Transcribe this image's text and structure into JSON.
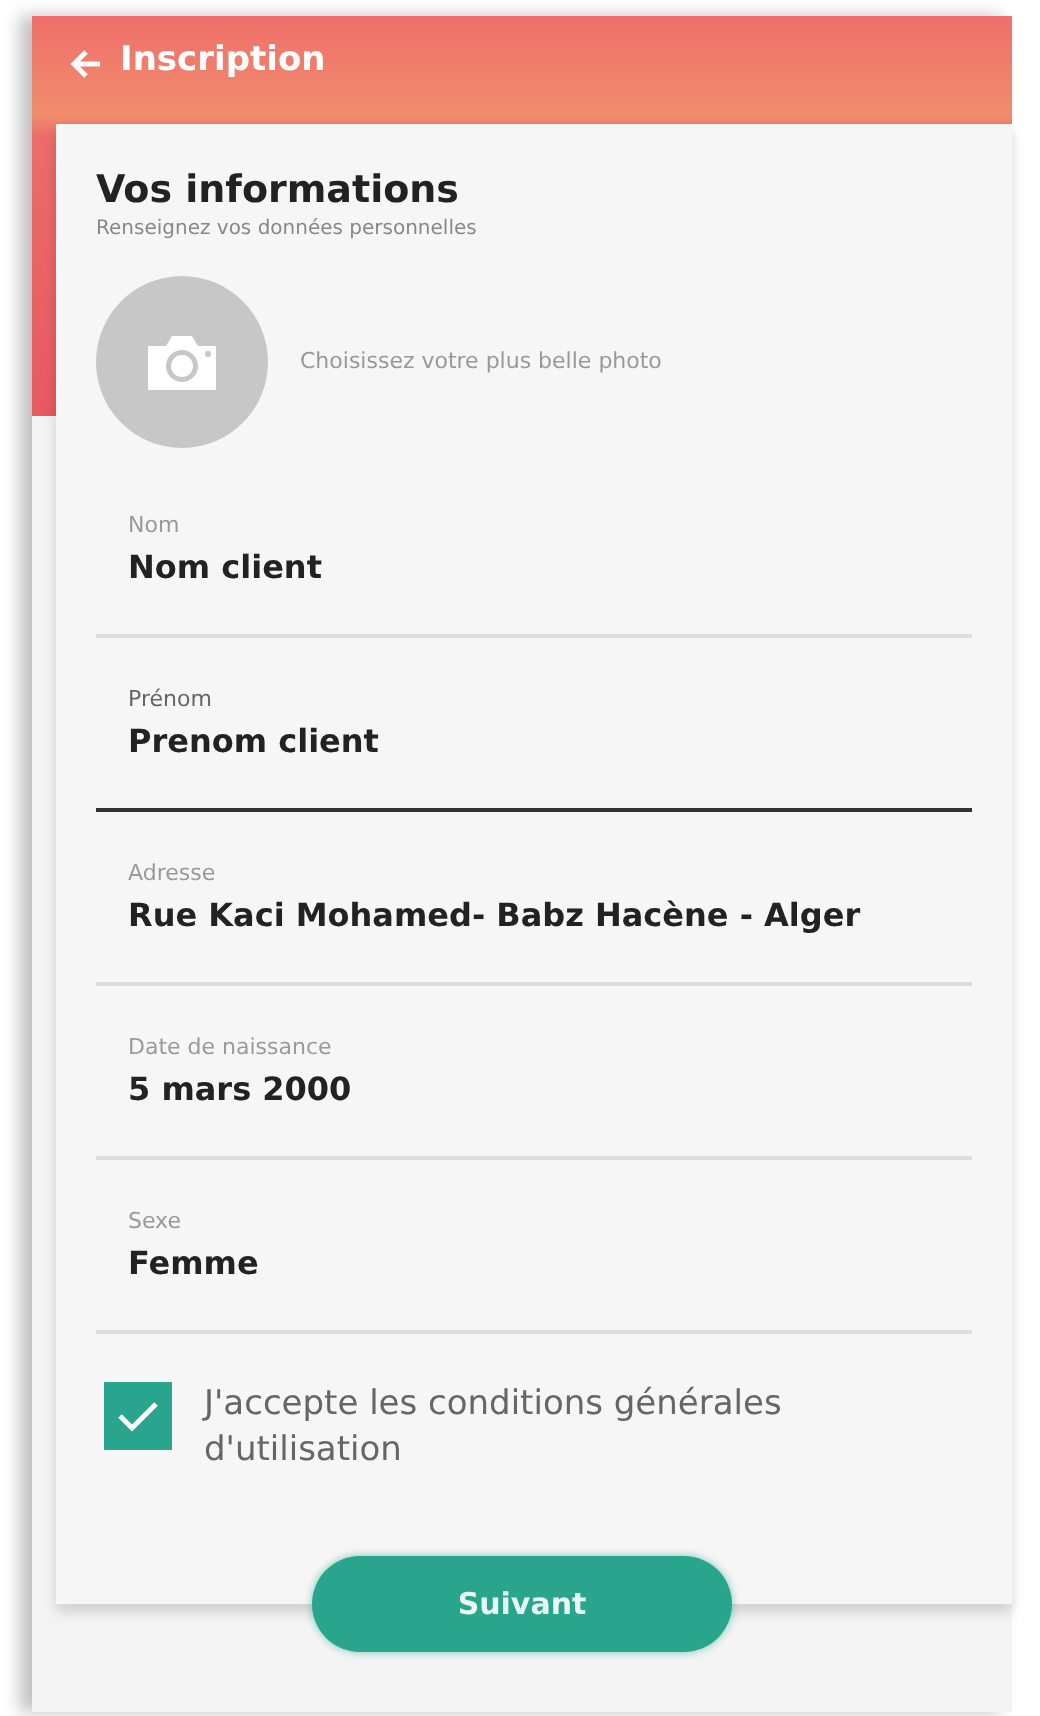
{
  "header": {
    "title": "Inscription"
  },
  "section": {
    "title": "Vos informations",
    "subtitle": "Renseignez vos données personnelles"
  },
  "photo": {
    "label": "Choisissez votre plus belle photo"
  },
  "fields": [
    {
      "label": "Nom",
      "value": "Nom client",
      "focused": false
    },
    {
      "label": "Prénom",
      "value": "Prenom client",
      "focused": true
    },
    {
      "label": "Adresse",
      "value": "Rue Kaci Mohamed- Babz Hacène - Alger",
      "focused": false
    },
    {
      "label": "Date de naissance",
      "value": "5 mars 2000",
      "focused": false
    },
    {
      "label": "Sexe",
      "value": "Femme",
      "focused": false
    }
  ],
  "terms": {
    "label": "J'accepte les conditions générales d'utilisation",
    "checked": true
  },
  "next_button": {
    "label": "Suivant"
  }
}
